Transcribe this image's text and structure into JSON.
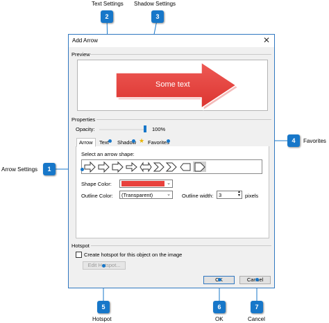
{
  "dialog": {
    "title": "Add Arrow",
    "preview_label": "Preview",
    "preview_text": "Some text",
    "properties_label": "Properties",
    "opacity_label": "Opacity:",
    "opacity_value": "100%",
    "opacity_level": 1.0,
    "tabs": [
      "Arrow",
      "Text",
      "Shadow",
      "Favorites"
    ],
    "select_shape_label": "Select an arrow shape:",
    "shape_color_label": "Shape Color:",
    "outline_color_label": "Outline Color:",
    "outline_color_value": "(Transparent)",
    "outline_width_label": "Outline width:",
    "outline_width_value": "3",
    "pixels_label": "pixels",
    "hotspot_label": "Hotspot",
    "hotspot_checkbox_label": "Create hotspot for this object on the image",
    "edit_hotspot_label": "Edit Hotspot...",
    "ok_label": "OK",
    "cancel_label": "Cancel"
  },
  "callouts": [
    {
      "number": "1",
      "label": "Arrow Settings"
    },
    {
      "number": "2",
      "label": "Text Settings"
    },
    {
      "number": "3",
      "label": "Shadow Settings"
    },
    {
      "number": "4",
      "label": "Favorites"
    },
    {
      "number": "5",
      "label": "Hotspot"
    },
    {
      "number": "6",
      "label": "OK"
    },
    {
      "number": "7",
      "label": "Cancel"
    }
  ],
  "colors": {
    "callout": "#1777c9",
    "shape_color": "#e8413c",
    "dialog_border": "#2f77c0"
  },
  "icons": [
    "close-icon",
    "star-icon",
    "dropdown-arrow-icon",
    "spinner-icon"
  ]
}
